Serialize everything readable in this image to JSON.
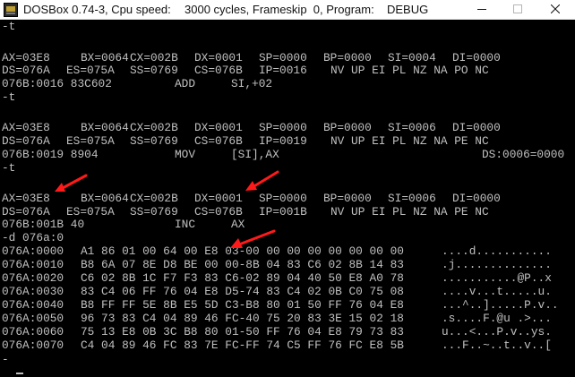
{
  "window": {
    "title": "DOSBox 0.74-3, Cpu speed:",
    "cycles": "3000 cycles, Frameskip  0, Program:",
    "program": "DEBUG",
    "accent": "#ff1a1a"
  },
  "console": {
    "l01": "-t",
    "l02": {
      "ax": "AX=03E8",
      "bx": "BX=0064",
      "cx": "CX=002B",
      "dx": "DX=0001",
      "sp": "SP=0000",
      "bp": "BP=0000",
      "si": "SI=0004",
      "di": "DI=0000"
    },
    "l03": {
      "ds": "DS=076A",
      "es": "ES=075A",
      "ss": "SS=0769",
      "cs": "CS=076B",
      "ip": "IP=0016",
      "flags": "NV UP EI PL NZ NA PO NC"
    },
    "l04": {
      "addr": "076B:0016 83C602",
      "op": "ADD",
      "args": "SI,+02",
      "extra": ""
    },
    "l05": "-t",
    "l06": {
      "ax": "AX=03E8",
      "bx": "BX=0064",
      "cx": "CX=002B",
      "dx": "DX=0001",
      "sp": "SP=0000",
      "bp": "BP=0000",
      "si": "SI=0006",
      "di": "DI=0000"
    },
    "l07": {
      "ds": "DS=076A",
      "es": "ES=075A",
      "ss": "SS=0769",
      "cs": "CS=076B",
      "ip": "IP=0019",
      "flags": "NV UP EI PL NZ NA PE NC"
    },
    "l08": {
      "addr": "076B:0019 8904",
      "op": "MOV",
      "args": "[SI],AX",
      "extra": "DS:0006=0000"
    },
    "l09": "-t",
    "l10": {
      "ax": "AX=03E8",
      "bx": "BX=0064",
      "cx": "CX=002B",
      "dx": "DX=0001",
      "sp": "SP=0000",
      "bp": "BP=0000",
      "si": "SI=0006",
      "di": "DI=0000"
    },
    "l11": {
      "ds": "DS=076A",
      "es": "ES=075A",
      "ss": "SS=0769",
      "cs": "CS=076B",
      "ip": "IP=001B",
      "flags": "NV UP EI PL NZ NA PE NC"
    },
    "l12": {
      "addr": "076B:001B 40",
      "op": "INC",
      "args": "AX",
      "extra": ""
    },
    "l13": "-d 076a:0",
    "dump": [
      {
        "addr": "076A:0000",
        "hex": "A1 86 01 00 64 00 E8 03-00 00 00 00 00 00 00 00",
        "ascii": "....d..........."
      },
      {
        "addr": "076A:0010",
        "hex": "B8 6A 07 8E D8 BE 00 00-8B 04 83 C6 02 8B 14 83",
        "ascii": ".j.............."
      },
      {
        "addr": "076A:0020",
        "hex": "C6 02 8B 1C F7 F3 83 C6-02 89 04 40 50 E8 A0 78",
        "ascii": "...........@P..x"
      },
      {
        "addr": "076A:0030",
        "hex": "83 C4 06 FF 76 04 E8 D5-74 83 C4 02 0B C0 75 08",
        "ascii": "....v...t.....u."
      },
      {
        "addr": "076A:0040",
        "hex": "B8 FF FF 5E 8B E5 5D C3-B8 80 01 50 FF 76 04 E8",
        "ascii": "...^..].....P.v.."
      },
      {
        "addr": "076A:0050",
        "hex": "96 73 83 C4 04 89 46 FC-40 75 20 83 3E 15 02 18",
        "ascii": ".s....F.@u .>..."
      },
      {
        "addr": "076A:0060",
        "hex": "75 13 E8 0B 3C B8 80 01-50 FF 76 04 E8 79 73 83",
        "ascii": "u...<...P.v..ys."
      },
      {
        "addr": "076A:0070",
        "hex": "C4 04 89 46 FC 83 7E FC-FF 74 C5 FF 76 FC E8 5B",
        "ascii": "...F..~..t..v..["
      }
    ],
    "prompt": "-"
  }
}
